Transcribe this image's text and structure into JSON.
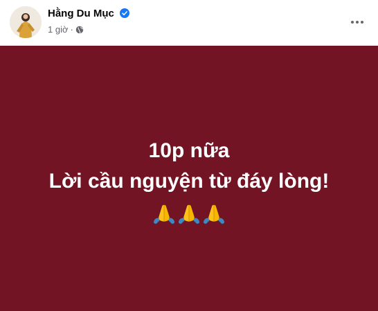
{
  "post": {
    "author_name": "Hằng Du Mục",
    "timestamp": "1 giờ",
    "separator": "·",
    "privacy_icon": "globe-icon",
    "verified_icon": "verified-badge-icon",
    "more_icon": "more-options-icon"
  },
  "card": {
    "background_color": "#731425",
    "line1": "10p nữa",
    "line2": "Lời cầu nguyện từ đáy lòng!",
    "emojis": [
      "folded-hands-emoji",
      "folded-hands-emoji",
      "folded-hands-emoji"
    ]
  },
  "colors": {
    "verified_blue": "#1877f2",
    "text_secondary": "#65676b"
  }
}
